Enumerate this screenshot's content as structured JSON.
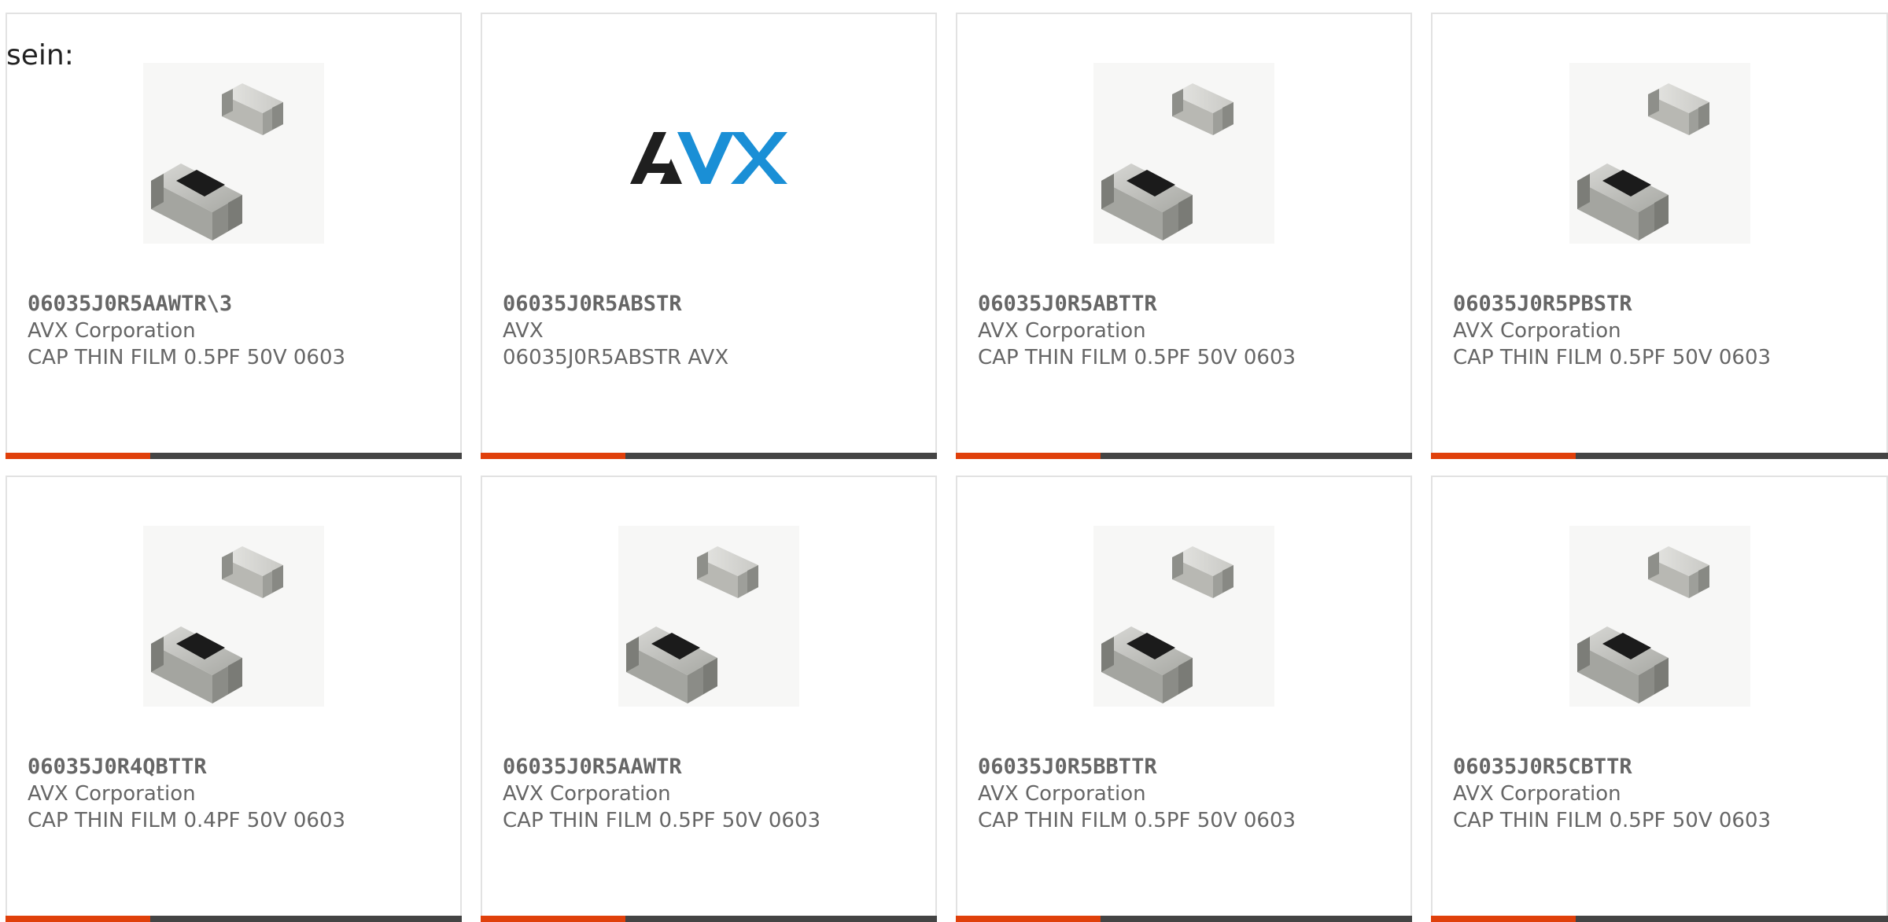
{
  "intro_text": "sein:",
  "colors": {
    "accent": "#e0400b",
    "bar": "#444444",
    "text": "#666666",
    "border": "#e2e2e2",
    "avx_black": "#1f1f1f",
    "avx_blue": "#1a8fd6"
  },
  "products": [
    {
      "part": "06035J0R5AAWTR\\3",
      "manufacturer": "AVX Corporation",
      "description": "CAP THIN FILM 0.5PF 50V 0603",
      "image": "chip-capacitor-icon"
    },
    {
      "part": "06035J0R5ABSTR",
      "manufacturer": "AVX",
      "description": "06035J0R5ABSTR AVX",
      "image": "avx-logo",
      "logo_text": "AVX"
    },
    {
      "part": "06035J0R5ABTTR",
      "manufacturer": "AVX Corporation",
      "description": "CAP THIN FILM 0.5PF 50V 0603",
      "image": "chip-capacitor-icon"
    },
    {
      "part": "06035J0R5PBSTR",
      "manufacturer": "AVX Corporation",
      "description": "CAP THIN FILM 0.5PF 50V 0603",
      "image": "chip-capacitor-icon"
    },
    {
      "part": "06035J0R4QBTTR",
      "manufacturer": "AVX Corporation",
      "description": "CAP THIN FILM 0.4PF 50V 0603",
      "image": "chip-capacitor-icon"
    },
    {
      "part": "06035J0R5AAWTR",
      "manufacturer": "AVX Corporation",
      "description": "CAP THIN FILM 0.5PF 50V 0603",
      "image": "chip-capacitor-icon"
    },
    {
      "part": "06035J0R5BBTTR",
      "manufacturer": "AVX Corporation",
      "description": "CAP THIN FILM 0.5PF 50V 0603",
      "image": "chip-capacitor-icon"
    },
    {
      "part": "06035J0R5CBTTR",
      "manufacturer": "AVX Corporation",
      "description": "CAP THIN FILM 0.5PF 50V 0603",
      "image": "chip-capacitor-icon"
    }
  ]
}
